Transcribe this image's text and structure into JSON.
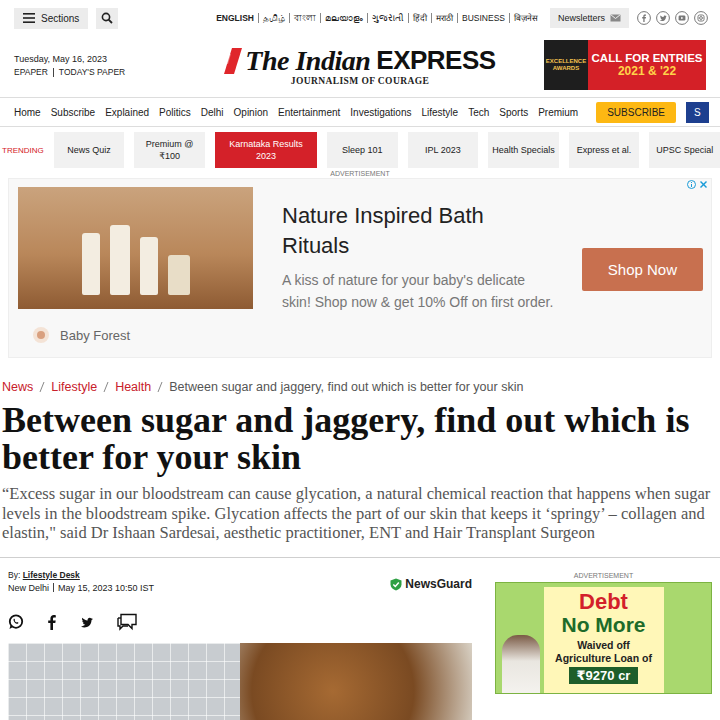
{
  "top_bar": {
    "sections": "Sections",
    "languages": [
      {
        "label": "ENGLISH",
        "selected": true
      },
      {
        "label": "தமிழ்",
        "selected": false
      },
      {
        "label": "বাংলা",
        "selected": false
      },
      {
        "label": "മലയാളം",
        "selected": false
      },
      {
        "label": "ગુજરાતી",
        "selected": false
      },
      {
        "label": "हिंदी",
        "selected": false
      },
      {
        "label": "मराठी",
        "selected": false
      },
      {
        "label": "BUSINESS",
        "selected": false
      },
      {
        "label": "बिज़नेस",
        "selected": false
      }
    ],
    "newsletters": "Newsletters"
  },
  "header": {
    "date": "Tuesday, May 16, 2023",
    "links": [
      "EPAPER",
      "TODAY'S PAPER"
    ],
    "logo": {
      "title": "The Indian",
      "title_strong": "EXPRESS",
      "tagline": "JOURNALISM OF COURAGE"
    },
    "banner": {
      "badge": "EXCELLENCE AWARDS",
      "headline": "CALL FOR ENTRIES",
      "years": "2021 & '22"
    }
  },
  "nav": {
    "items": [
      "Home",
      "Subscribe",
      "Explained",
      "Politics",
      "Delhi",
      "Opinion",
      "Entertainment",
      "Investigations",
      "Lifestyle",
      "Tech",
      "Sports",
      "Premium"
    ],
    "subscribe_button": "SUBSCRIBE",
    "cut_item": "S"
  },
  "trending": {
    "label": "TRENDING",
    "chips": [
      {
        "label": "News Quiz",
        "selected": false
      },
      {
        "label": "Premium @ ₹100",
        "selected": false
      },
      {
        "label": "Karnataka Results 2023",
        "selected": true
      },
      {
        "label": "Sleep 101",
        "selected": false
      },
      {
        "label": "IPL 2023",
        "selected": false
      },
      {
        "label": "Health Specials",
        "selected": false
      },
      {
        "label": "Express et al.",
        "selected": false
      },
      {
        "label": "UPSC Special",
        "selected": false
      }
    ]
  },
  "top_ad": {
    "label": "ADVERTISEMENT",
    "brand": "Baby Forest",
    "title": "Nature Inspired Bath Rituals",
    "text": "A kiss of nature for your baby's delicate skin! Shop now & get 10% Off on first order.",
    "button": "Shop Now"
  },
  "article": {
    "breadcrumb": [
      {
        "label": "News",
        "current": false
      },
      {
        "label": "Lifestyle",
        "current": false
      },
      {
        "label": "Health",
        "current": false
      },
      {
        "label": "Between sugar and jaggery, find out which is better for your skin",
        "current": true
      }
    ],
    "headline": "Between sugar and jaggery, find out which is better for your skin",
    "standfirst": "“Excess sugar in our bloodstream can cause glycation, a natural chemical reaction that happens when sugar levels in the bloodstream spike. Glycation affects the part of our skin that keeps it ‘springy’ – collagen and elastin,\" said Dr Ishaan Sardesai, aesthetic practitioner, ENT and Hair Transplant Surgeon",
    "byline": {
      "prefix": "By:",
      "author": "Lifestyle Desk",
      "location": "New Delhi",
      "date": "May 15, 2023 10:50 IST"
    },
    "newsguard": "NewsGuard"
  },
  "sidebar_ad": {
    "label": "ADVERTISEMENT",
    "title_top": "Debt",
    "title_bottom": "No More",
    "line1": "Waived off",
    "line2": "Agriculture Loan of",
    "amount": "₹9270 cr"
  }
}
